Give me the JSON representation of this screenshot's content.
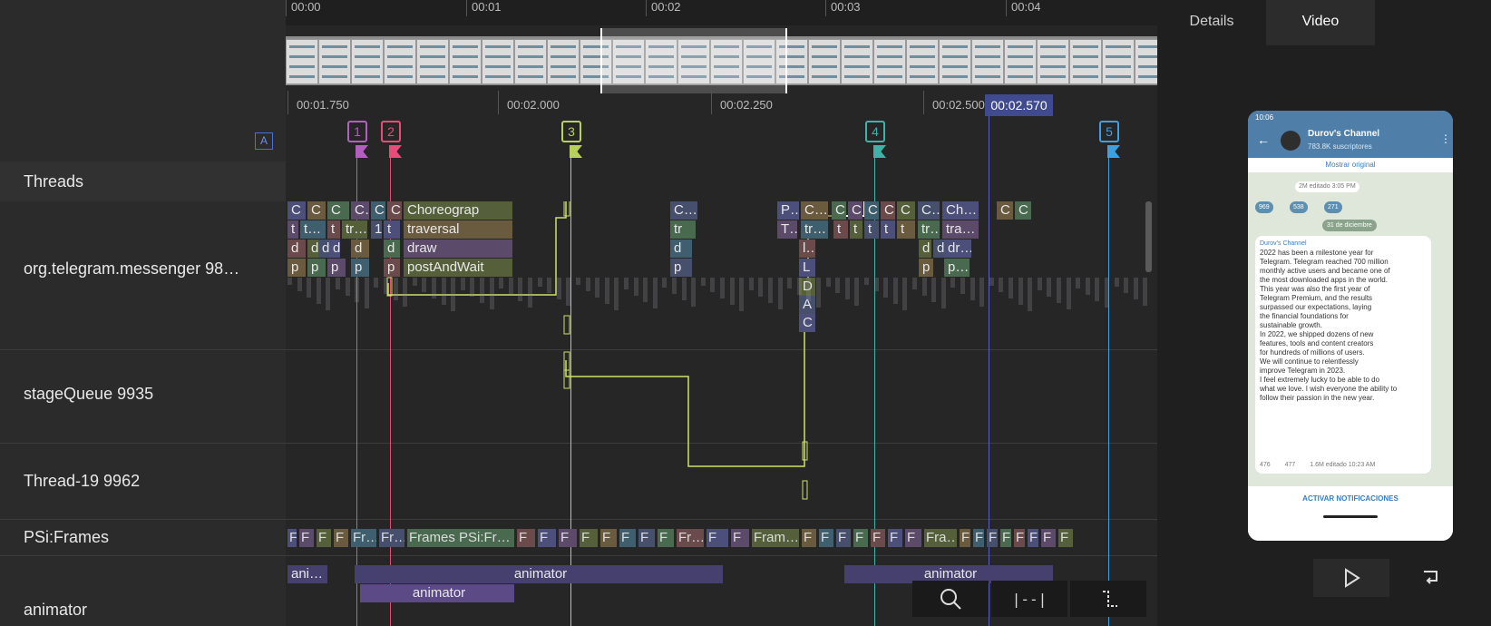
{
  "time_ruler": {
    "ticks": [
      "00:00",
      "00:01",
      "00:02",
      "00:03",
      "00:04"
    ]
  },
  "zoom_ruler": {
    "ticks": [
      "00:01.750",
      "00:02.000",
      "00:02.250",
      "00:02.500"
    ],
    "cursor": "00:02.570"
  },
  "track_group_badge": "A",
  "markers": [
    {
      "label": "1",
      "color": "#b25fc0"
    },
    {
      "label": "2",
      "color": "#e84d7a"
    },
    {
      "label": "3",
      "color": "#b7d15a"
    },
    {
      "label": "4",
      "color": "#3fb3a8"
    },
    {
      "label": "5",
      "color": "#3f9fe0"
    }
  ],
  "cursor_line_color": "#5a62c8",
  "threads_header": "Threads",
  "threads": [
    {
      "name": "org.telegram.messenger 98…"
    },
    {
      "name": "stageQueue 9935"
    },
    {
      "name": "Thread-19 9962"
    },
    {
      "name": "PSi:Frames"
    },
    {
      "name": "animator"
    }
  ],
  "main_thread_slices": {
    "row1": [
      "C",
      "C",
      "C",
      "C…",
      "C",
      "C",
      "Choreograp",
      "C…",
      "P…",
      "C…",
      "C",
      "C",
      "C",
      "C",
      "C",
      "C…",
      "Ch…",
      "C",
      "C"
    ],
    "row2": [
      "t",
      "t…",
      "t",
      "tr…",
      "1",
      "t",
      "traversal",
      "tr",
      "T…",
      "tr…",
      "t",
      "t",
      "t",
      "t",
      "t",
      "tr…",
      "tra…"
    ],
    "row3": [
      "d",
      "d",
      "d",
      "d",
      "d",
      "d",
      "draw",
      "d",
      "l…",
      "d",
      "d",
      "dr…"
    ],
    "row4": [
      "p",
      "p",
      "p",
      "p",
      "p",
      "postAndWait",
      "p",
      "L",
      "p",
      "p…"
    ],
    "row5": [
      "D",
      "A",
      "C"
    ]
  },
  "frames_slices": [
    "F",
    "F",
    "F",
    "F",
    "Fr…",
    "Fr…",
    "Frames PSi:Fr…",
    "F",
    "F",
    "F",
    "F",
    "F",
    "F",
    "F",
    "F",
    "Fr…",
    "F",
    "F",
    "Fram…",
    "F",
    "F",
    "F",
    "F",
    "F",
    "F",
    "F",
    "Fra…",
    "F",
    "F",
    "F",
    "F",
    "F",
    "F",
    "F",
    "F"
  ],
  "animator_slices": [
    "ani…",
    "animator",
    "animator",
    "animator"
  ],
  "zoom_controls": {
    "zoom": "search-icon",
    "fit": "|--|",
    "corner": "corner-icon"
  },
  "tabs": {
    "details": "Details",
    "video": "Video"
  },
  "phone": {
    "time": "10:06",
    "channel_name": "Durov's Channel",
    "subscribers": "783.8K suscriptores",
    "translate": "Mostrar original",
    "views_edited": "2M  editado 3:05 PM",
    "reactions": [
      "969",
      "538",
      "271"
    ],
    "date_chip": "31 de diciembre",
    "post_author": "Durov's Channel",
    "post_text": [
      "2022 has been a milestone year for",
      "Telegram. Telegram reached 700 million",
      "monthly active users and became one of",
      "the most downloaded apps in the world.",
      "This year was also the first year of",
      "Telegram Premium, and the results",
      "surpassed our expectations, laying",
      "the financial foundations for",
      "sustainable growth.",
      "In 2022, we shipped dozens of new",
      "features, tools and content creators",
      "for hundreds of millions of users.",
      "We will continue to relentlessly",
      "improve Telegram in 2023.",
      "I feel extremely lucky to be able to do",
      "what we love. I wish everyone the ability to",
      "follow their passion in the new year."
    ],
    "post_reactions": [
      "476",
      "477"
    ],
    "post_footer": "1.6M  editado 10:23 AM",
    "cta": "ACTIVAR NOTIFICACIONES"
  }
}
